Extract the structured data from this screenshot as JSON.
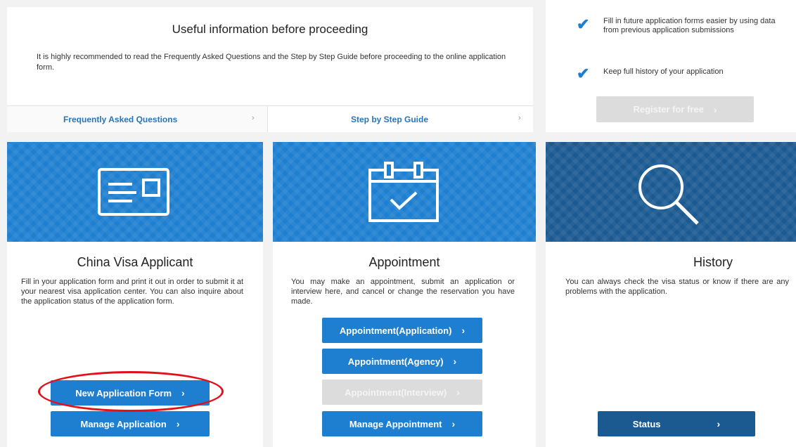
{
  "info": {
    "title": "Useful information before proceeding",
    "text": "It is highly recommended to read the Frequently Asked Questions and the Step by Step Guide before proceeding to the online application form.",
    "faq_label": "Frequently Asked Questions",
    "guide_label": "Step by Step Guide",
    "chevron": "›"
  },
  "register": {
    "feature1": "Fill in future application forms easier by using data from previous application submissions",
    "feature2": "Keep full history of your application",
    "button_label": "Register for free",
    "chevron": "›"
  },
  "applicant": {
    "title": "China Visa Applicant",
    "description": "Fill in your application form and print it out in order to submit it at your nearest visa application center. You can also inquire about the application status of the application form.",
    "buttons": [
      {
        "label": "New Application Form",
        "arrow": "›"
      },
      {
        "label": "Manage Application",
        "arrow": "›"
      }
    ]
  },
  "appointment": {
    "title": "Appointment",
    "description": "You may make an appointment, submit an application or interview here, and cancel or change the reservation you have made.",
    "buttons": [
      {
        "label": "Appointment(Application)",
        "arrow": "›"
      },
      {
        "label": "Appointment(Agency)",
        "arrow": "›"
      },
      {
        "label": "Appointment(Interview)",
        "arrow": "›"
      },
      {
        "label": "Manage Appointment",
        "arrow": "›"
      }
    ]
  },
  "history": {
    "title": "History",
    "description": "You can always check the visa status or know if there are any problems with the application.",
    "button_label": "Status",
    "arrow": "›"
  },
  "colors": {
    "accent_blue": "#1e7fd0",
    "navy": "#1a5a91",
    "highlight_red": "#e3101a"
  }
}
